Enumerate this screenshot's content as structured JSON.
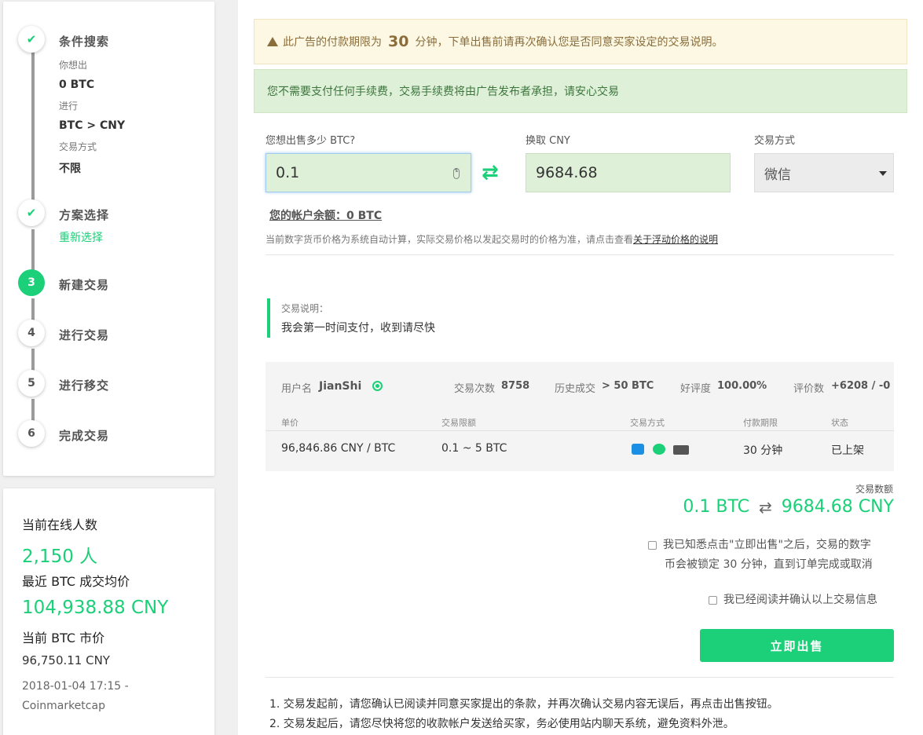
{
  "steps": {
    "step1": {
      "title": "条件搜索",
      "sub1": "你想出",
      "val1": "0 BTC",
      "sub2": "进行",
      "val2": "BTC > CNY",
      "sub3": "交易方式",
      "val3": "不限"
    },
    "step2": {
      "title": "方案选择",
      "link": "重新选择"
    },
    "step3": {
      "num": "3",
      "title": "新建交易"
    },
    "step4": {
      "num": "4",
      "title": "进行交易"
    },
    "step5": {
      "num": "5",
      "title": "进行移交"
    },
    "step6": {
      "num": "6",
      "title": "完成交易"
    }
  },
  "stats": {
    "online_label": "当前在线人数",
    "online_value": "2,150 人",
    "avg_label": "最近 BTC 成交均价",
    "avg_value": "104,938.88 CNY",
    "market_label": "当前 BTC 市价",
    "market_value": "96,750.11 CNY",
    "source_line1": "2018-01-04 17:15 -",
    "source_line2": "Coinmarketcap"
  },
  "warning": {
    "prefix": "此广告的付款期限为",
    "minutes": "30",
    "suffix": "分钟，下单出售前请再次确认您是否同意买家设定的交易说明。"
  },
  "info": "您不需要支付任何手续费，交易手续费将由广告发布者承担，请安心交易",
  "form": {
    "btc_label": "您想出售多少 BTC?",
    "btc_value": "0.1",
    "cny_label": "换取 CNY",
    "cny_value": "9684.68",
    "method_label": "交易方式",
    "method_value": "微信"
  },
  "balance": "您的帐户余额：0 BTC",
  "price_note": "当前数字货币价格为系统自动计算，实际交易价格以发起交易时的价格为准，请点击查看",
  "price_note_link": "关于浮动价格的说明",
  "terms": {
    "label": "交易说明：",
    "text": "我会第一时间支付，收到请尽快"
  },
  "seller": {
    "username_label": "用户名",
    "username": "JianShi",
    "trades_label": "交易次数",
    "trades": "8758",
    "history_label": "历史成交",
    "history": "> 50 BTC",
    "rating_label": "好评度",
    "rating": "100.00%",
    "reviews_label": "评价数",
    "reviews": "+6208 / -0",
    "headers": [
      "单价",
      "交易限额",
      "交易方式",
      "付款期限",
      "状态"
    ],
    "price": "96,846.86 CNY / BTC",
    "limit": "0.1 ~ 5 BTC",
    "payment_icons": [
      "alipay-icon",
      "wechat-icon",
      "bank-card-icon"
    ],
    "deadline": "30 分钟",
    "status": "已上架"
  },
  "amount": {
    "label": "交易数额",
    "btc": "0.1 BTC",
    "cny": "9684.68 CNY"
  },
  "checks": {
    "lock_line1": "我已知悉点击\"立即出售\"之后，交易的数字",
    "lock_line2": "币会被锁定 30 分钟，直到订单完成或取消",
    "confirm": "我已经阅读并确认以上交易信息"
  },
  "sell_button": "立即出售",
  "notices": [
    "1. 交易发起前，请您确认已阅读并同意买家提出的条款，并再次确认交易内容无误后，再点击出售按钮。",
    "2. 交易发起后，请您尽快将您的收款帐户发送给买家，务必使用站内聊天系统，避免资料外泄。"
  ],
  "colors": {
    "accent": "#1bd078",
    "warning_bg": "#fcf8e3",
    "info_bg": "#dff0d8"
  }
}
